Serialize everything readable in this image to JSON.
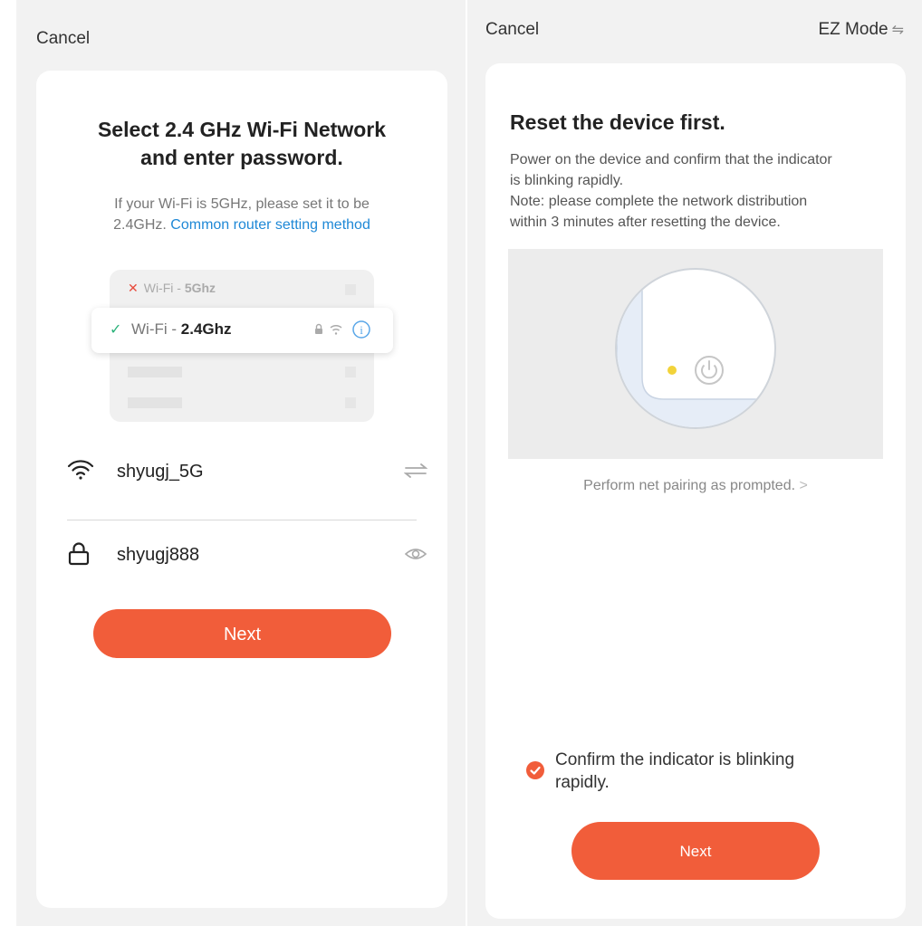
{
  "left": {
    "cancel_label": "Cancel",
    "title_line1": "Select 2.4 GHz Wi-Fi Network",
    "title_line2": "and enter password.",
    "subtitle_line1": "If your Wi-Fi is 5GHz, please set it to be",
    "subtitle_line2_prefix": "2.4GHz. ",
    "router_link": "Common router setting method",
    "illustration": {
      "row_5g_prefix": "Wi-Fi - ",
      "row_5g_band": "5Ghz",
      "row_24_prefix": "Wi-Fi - ",
      "row_24_band": "2.4Ghz"
    },
    "ssid_value": "shyugj_5G",
    "password_value": "shyugj888",
    "next_label": "Next"
  },
  "right": {
    "cancel_label": "Cancel",
    "mode_label": "EZ Mode",
    "title": "Reset the device first.",
    "desc_line1": "Power on the device and confirm that the indicator",
    "desc_line2": "is blinking rapidly.",
    "desc_line3": "Note: please complete the network distribution",
    "desc_line4": "within 3 minutes after resetting the device.",
    "prompt_link": "Perform net pairing as prompted.",
    "confirm_line1": "Confirm the indicator is blinking",
    "confirm_line2": "rapidly.",
    "next_label": "Next"
  },
  "colors": {
    "accent": "#f15d3a",
    "link": "#1e88d6",
    "check_green": "#2bb27a",
    "error_red": "#e84a3c",
    "indicator_yellow": "#f2d33a"
  }
}
